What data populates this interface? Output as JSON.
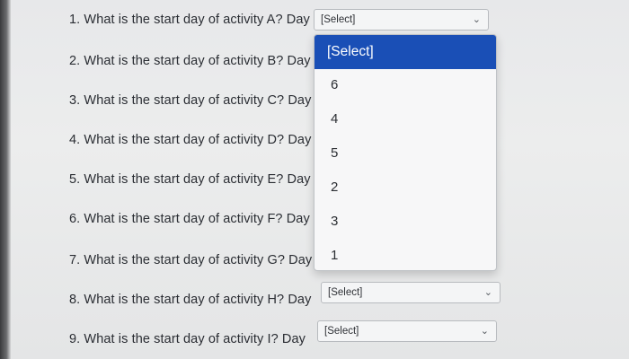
{
  "questions": [
    {
      "text": "1. What is the start day of activity A? Day",
      "select": "[Select]"
    },
    {
      "text": "2. What is the start day of activity B? Day"
    },
    {
      "text": "3. What is the start day of activity C? Day"
    },
    {
      "text": "4. What is the start day of activity D? Day"
    },
    {
      "text": "5. What is the start day of activity E? Day"
    },
    {
      "text": "6. What is the start day of activity F? Day"
    },
    {
      "text": "7. What is the start day of activity G? Day"
    },
    {
      "text": "8. What is the start day of activity H? Day",
      "select": "[Select]"
    },
    {
      "text": "9. What is the start day of activity I? Day",
      "select": "[Select]"
    }
  ],
  "dropdown": {
    "options": [
      "[Select]",
      "6",
      "4",
      "5",
      "2",
      "3",
      "1"
    ],
    "highlighted_index": 0,
    "highlight_color": "#1a4fb6"
  },
  "icons": {
    "select_chevron": "chevron-down-icon"
  }
}
